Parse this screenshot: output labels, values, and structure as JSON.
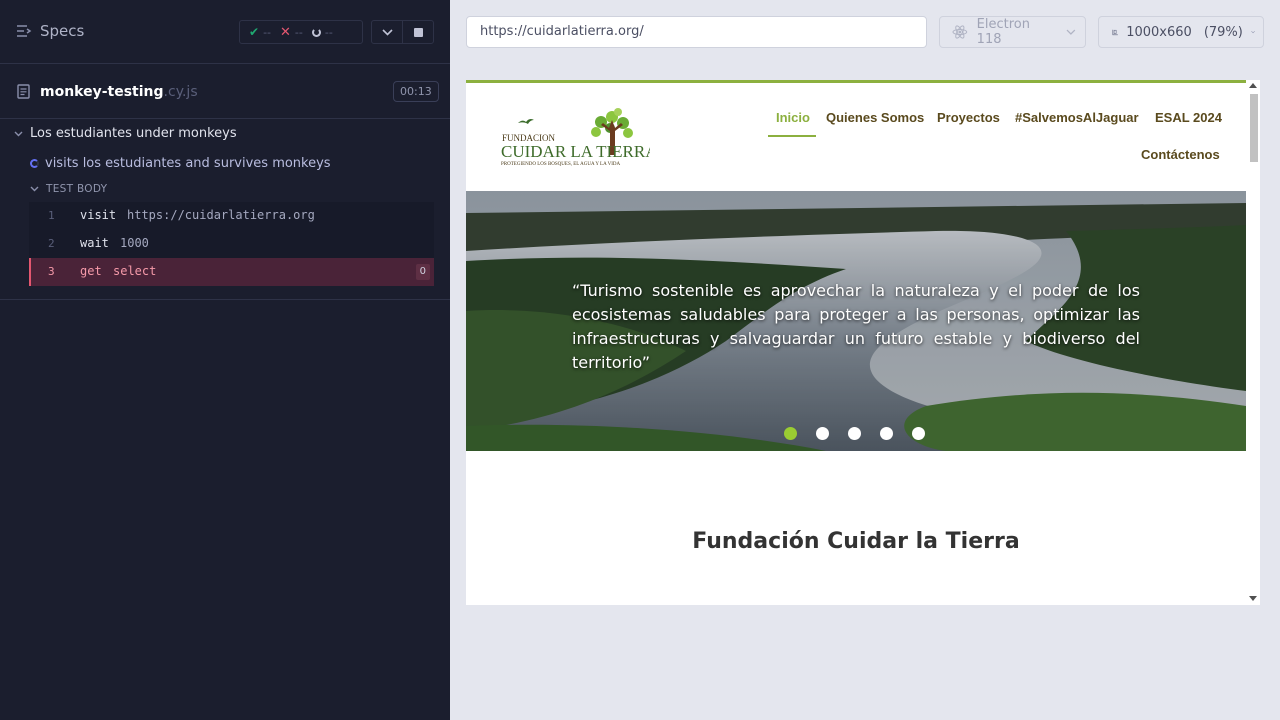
{
  "reporter": {
    "specs_label": "Specs",
    "stats": {
      "passed": "--",
      "failed": "--",
      "pending": "--"
    },
    "spec": {
      "name": "monkey-testing",
      "ext": ".cy.js",
      "duration": "00:13"
    },
    "suite": {
      "title": "Los estudiantes under monkeys"
    },
    "test": {
      "title": "visits los estudiantes and survives monkeys"
    },
    "section_label": "TEST BODY",
    "commands": [
      {
        "num": "1",
        "name": "visit",
        "message": "https://cuidarlatierra.org"
      },
      {
        "num": "2",
        "name": "wait",
        "message": "1000"
      },
      {
        "num": "3",
        "name": "get",
        "message": "select",
        "count": "0"
      }
    ],
    "colors": {
      "pass": "#1fa971",
      "fail": "#e45770",
      "running": "#6470f3"
    }
  },
  "preview": {
    "url": "https://cuidarlatierra.org/",
    "browser": "Electron 118",
    "viewport": "1000x660",
    "scale": "(79%)"
  },
  "site": {
    "logo": {
      "top": "FUNDACION",
      "main": "CUIDAR LA TIERRA",
      "tagline": "PROTEGIENDO LOS BOSQUES, EL AGUA Y LA VIDA"
    },
    "nav": [
      {
        "label": "Inicio",
        "active": true
      },
      {
        "label": "Quienes Somos"
      },
      {
        "label": "Proyectos"
      },
      {
        "label": "#SalvemosAlJaguar"
      },
      {
        "label": "ESAL 2024"
      },
      {
        "label": "Contáctenos"
      }
    ],
    "hero": {
      "quote": "“Turismo sostenible es aprovechar la naturaleza y el poder de los ecosistemas saludables para proteger a las personas, optimizar las infraestructuras y salvaguardar un futuro estable y biodiverso del territorio”",
      "slides": 5,
      "active_slide": 1
    },
    "section_title": "Fundación Cuidar la Tierra",
    "colors": {
      "accent": "#8cb03f",
      "nav_text": "#5a4a1e",
      "dot_active": "#9acd32"
    }
  }
}
